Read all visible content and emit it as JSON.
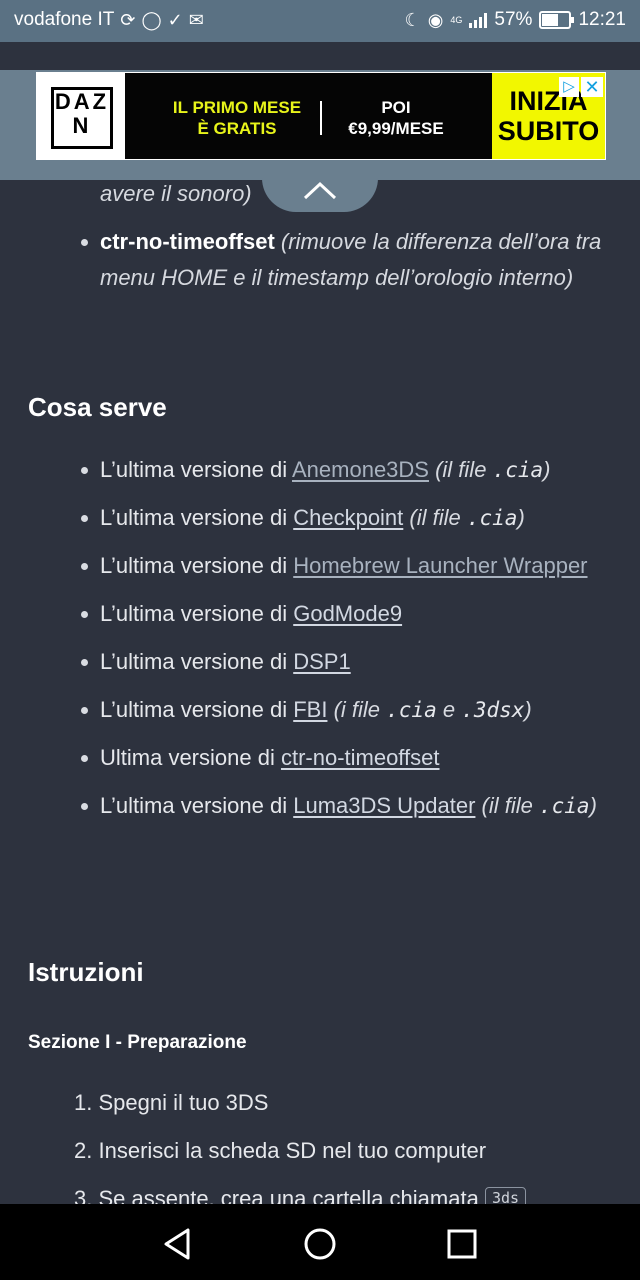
{
  "status_bar": {
    "carrier": "vodafone IT",
    "network": "4G",
    "battery": "57%",
    "battery_level": 0.57,
    "time": "12:21"
  },
  "ad": {
    "brand": "DAZN",
    "offer_line1": "IL PRIMO MESE",
    "offer_line2": "È GRATIS",
    "price_line1": "POI",
    "price_line2": "€9,99/MESE",
    "cta_line1": "INIZIA",
    "cta_line2": "SUBITO",
    "close": "✕"
  },
  "top_list": {
    "partial_item_end": "avere il sonoro)",
    "item_ctr_name": "ctr-no-timeoffset",
    "item_ctr_desc": "(rimuove la differenza dell’ora tra menu HOME e il timestamp dell’orologio interno)"
  },
  "cosa_serve": {
    "heading": "Cosa serve",
    "items": [
      {
        "prefix": "L’ultima versione di ",
        "link": "Anemone3DS",
        "suffix_open": " (il file ",
        "code": ".cia",
        "suffix_close": ")"
      },
      {
        "prefix": "L’ultima versione di ",
        "link": "Checkpoint",
        "suffix_open": " (il file ",
        "code": ".cia",
        "suffix_close": ")"
      },
      {
        "prefix": "L’ultima versione di ",
        "link": "Homebrew Launcher Wrapper"
      },
      {
        "prefix": "L’ultima versione di ",
        "link": "GodMode9"
      },
      {
        "prefix": "L’ultima versione di ",
        "link": "DSP1"
      },
      {
        "prefix": "L’ultima versione di ",
        "link": "FBI",
        "suffix_open": " (i file ",
        "code": ".cia",
        "middle": " e ",
        "code2": ".3dsx",
        "suffix_close": ")"
      },
      {
        "prefix": "Ultima versione di ",
        "link": "ctr-no-timeoffset"
      },
      {
        "prefix": "L’ultima versione di ",
        "link": "Luma3DS Updater",
        "suffix_open": " (il file ",
        "code": ".cia",
        "suffix_close": ")"
      }
    ]
  },
  "istruzioni": {
    "heading": "Istruzioni",
    "section_title": "Sezione I - Preparazione",
    "steps": [
      {
        "num": "1.",
        "text": "Spegni il tuo 3DS"
      },
      {
        "num": "2.",
        "text": "Inserisci la scheda SD nel tuo computer"
      },
      {
        "num": "3.",
        "text": "Se assente, crea una cartella chiamata",
        "code": "3ds"
      }
    ]
  }
}
